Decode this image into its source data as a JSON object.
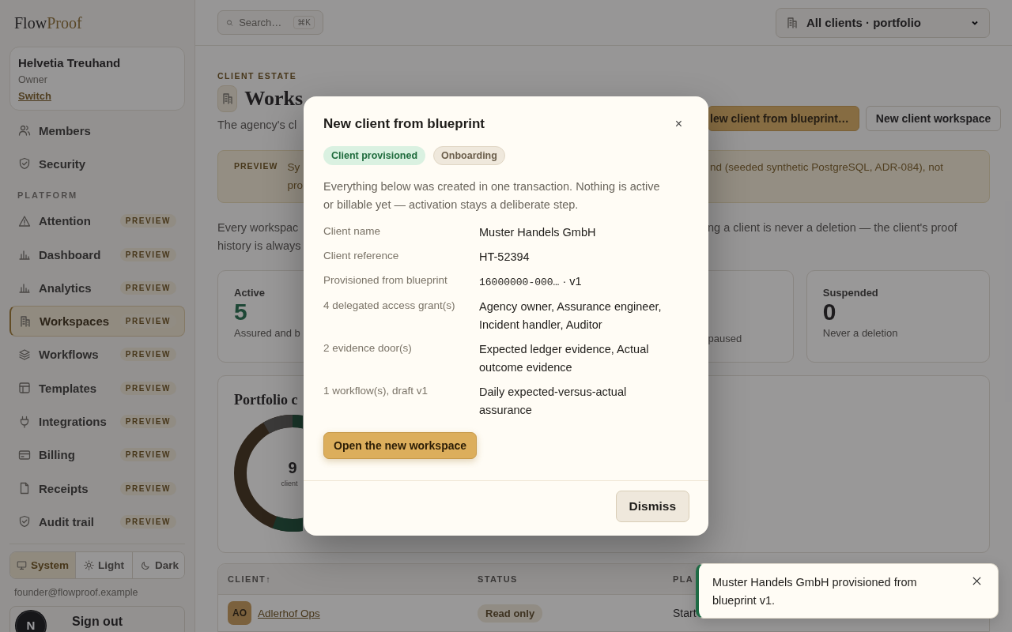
{
  "sidebar": {
    "brand": {
      "text": "Flow",
      "accent": "Proof"
    },
    "org": {
      "name": "Helvetia Treuhand",
      "role": "Owner",
      "switch_link": "Switch"
    },
    "account_items": [
      {
        "label": "Members",
        "selected": false
      },
      {
        "label": "Security",
        "selected": false
      }
    ],
    "section_label": "PLATFORM",
    "platform_items": [
      {
        "label": "Attention",
        "badge": "PREVIEW",
        "selected": false
      },
      {
        "label": "Dashboard",
        "badge": "PREVIEW",
        "selected": false
      },
      {
        "label": "Analytics",
        "badge": "PREVIEW",
        "selected": false
      },
      {
        "label": "Workspaces",
        "badge": "PREVIEW",
        "selected": true
      },
      {
        "label": "Workflows",
        "badge": "PREVIEW",
        "selected": false
      },
      {
        "label": "Templates",
        "badge": "PREVIEW",
        "selected": false
      },
      {
        "label": "Integrations",
        "badge": "PREVIEW",
        "selected": false
      },
      {
        "label": "Billing",
        "badge": "PREVIEW",
        "selected": false
      },
      {
        "label": "Receipts",
        "badge": "PREVIEW",
        "selected": false
      },
      {
        "label": "Audit trail",
        "badge": "PREVIEW",
        "selected": false
      }
    ],
    "theme_options": [
      {
        "label": "System",
        "selected": true
      },
      {
        "label": "Light",
        "selected": false
      },
      {
        "label": "Dark",
        "selected": false
      }
    ],
    "email": "founder@flowproof.example",
    "sign_out": "Sign out",
    "dev_badge": "N"
  },
  "topbar": {
    "search": {
      "placeholder": "Search…",
      "shortcut": "⌘K"
    },
    "client_selector": "All clients · portfolio"
  },
  "page": {
    "eyebrow": "CLIENT ESTATE",
    "title": "Works",
    "subtitle": "The agency's cl",
    "actions": [
      {
        "label": "lew client from blueprint…",
        "kind": "primary"
      },
      {
        "label": "New client workspace",
        "kind": "secondary"
      }
    ],
    "preview_banner": {
      "label": "PREVIEW",
      "left_lines": [
        "Sy",
        "pro"
      ],
      "right_line": "nd (seeded synthetic PostgreSQL, ADR-084), not"
    },
    "intro": {
      "left_lines": [
        "Every workspac",
        "history is always"
      ],
      "right_line": "ng a client is never a deletion — the client's proof"
    },
    "stats": [
      {
        "label": "Active",
        "value": "5",
        "note": "Assured and b",
        "kind": "positive"
      },
      {
        "note": "paused"
      },
      {
        "label": "Suspended",
        "value": "0",
        "note": "Never a deletion",
        "kind": "neutral"
      }
    ],
    "portfolio": {
      "title": "Portfolio c",
      "total": "9",
      "caption": "client"
    },
    "table": {
      "columns": [
        {
          "label": "CLIENT",
          "sort_indicator": "↑"
        },
        {
          "label": "STATUS"
        },
        {
          "label": "PLA"
        }
      ],
      "rows": [
        {
          "initials": "AO",
          "client": "Adlerhof Ops",
          "status": "Read only",
          "plan": "Start"
        }
      ]
    }
  },
  "modal": {
    "title": "New client from blueprint",
    "close": "×",
    "badges": [
      {
        "label": "Client provisioned",
        "kind": "success"
      },
      {
        "label": "Onboarding",
        "kind": "neutral"
      }
    ],
    "description": "Everything below was created in one transaction. Nothing is active or billable yet — activation stays a deliberate step.",
    "details": [
      {
        "label": "Client name",
        "kind": "text",
        "value": "Muster Handels GmbH"
      },
      {
        "label": "Client reference",
        "kind": "text",
        "value": "HT-52394"
      },
      {
        "label": "Provisioned from blueprint",
        "kind": "id",
        "id": "16000000-000…",
        "value": "· v1"
      },
      {
        "label": "4 delegated access grant(s)",
        "kind": "text",
        "value": "Agency owner, Assurance engineer, Incident handler, Auditor"
      },
      {
        "label": "2 evidence door(s)",
        "kind": "text",
        "value": "Expected ledger evidence, Actual outcome evidence"
      },
      {
        "label": "1 workflow(s), draft v1",
        "kind": "text",
        "value": "Daily expected-versus-actual assurance"
      }
    ],
    "primary_action": "Open the new workspace",
    "dismiss": "Dismiss"
  },
  "toast": {
    "message": "Muster Handels GmbH provisioned from blueprint v1."
  }
}
